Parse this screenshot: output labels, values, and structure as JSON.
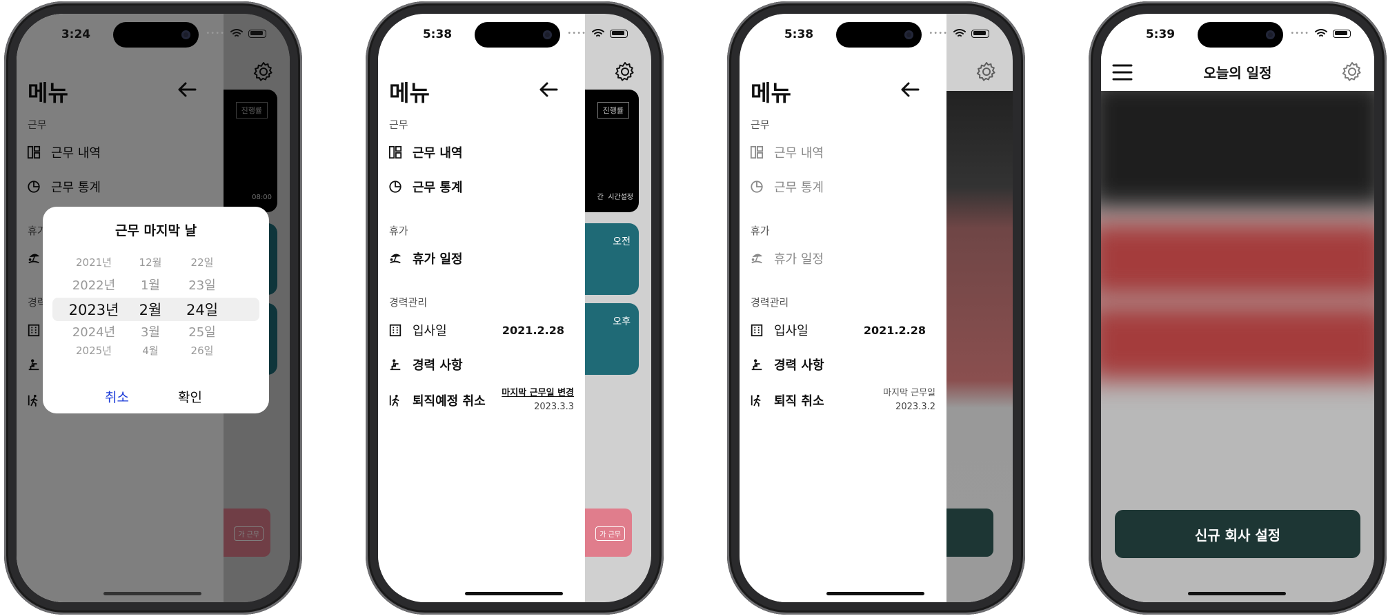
{
  "phones": [
    {
      "time": "3:24",
      "menu_title": "메뉴",
      "sections": {
        "work": "근무",
        "vacation": "휴가",
        "career": "경력관리"
      },
      "items": {
        "history": "근무 내역",
        "stats": "근무 통계"
      },
      "behind": {
        "progress_pill": "진행률",
        "footer_time": "08:00"
      },
      "dialog": {
        "title": "근무 마지막 날",
        "years": [
          "2021년",
          "2022년",
          "2023년",
          "2024년",
          "2025년"
        ],
        "months": [
          "12월",
          "1월",
          "2월",
          "3월",
          "4월"
        ],
        "days": [
          "22일",
          "23일",
          "24일",
          "25일",
          "26일"
        ],
        "cancel": "취소",
        "confirm": "확인"
      }
    },
    {
      "time": "5:38",
      "menu_title": "메뉴",
      "sections": {
        "work": "근무",
        "vacation": "휴가",
        "career": "경력관리"
      },
      "items": {
        "history": "근무 내역",
        "stats": "근무 통계",
        "vacation_schedule": "휴가 일정",
        "join_date": "입사일",
        "join_date_value": "2021.2.28",
        "career": "경력 사항",
        "retire": "퇴직예정 취소",
        "retire_sub_label": "마지막 근무일 변경",
        "retire_sub_value": "2023.3.3"
      },
      "behind": {
        "progress_pill": "진행률",
        "footer_a": "간",
        "footer_b": "시간설정",
        "am": "오전",
        "pm": "오후",
        "pink_label": "가 근무"
      }
    },
    {
      "time": "5:38",
      "menu_title": "메뉴",
      "sections": {
        "work": "근무",
        "vacation": "휴가",
        "career": "경력관리"
      },
      "items": {
        "history": "근무 내역",
        "stats": "근무 통계",
        "vacation_schedule": "휴가 일정",
        "join_date": "입사일",
        "join_date_value": "2021.2.28",
        "career": "경력 사항",
        "retire": "퇴직 취소",
        "retire_sub_label": "마지막 근무일",
        "retire_sub_value": "2023.3.2"
      }
    },
    {
      "time": "5:39",
      "header_title": "오늘의 일정",
      "cta": "신규 회사 설정"
    }
  ],
  "colors": {
    "teal": "#1f6a76",
    "pink": "#e07d8c",
    "dark_green": "#1d3634",
    "confirm_blue": "#1a3ad8"
  },
  "icons": [
    "gear-icon",
    "back-arrow-icon",
    "layout-icon",
    "pie-chart-icon",
    "beach-icon",
    "building-icon",
    "career-icon",
    "walk-icon",
    "hamburger-icon"
  ]
}
